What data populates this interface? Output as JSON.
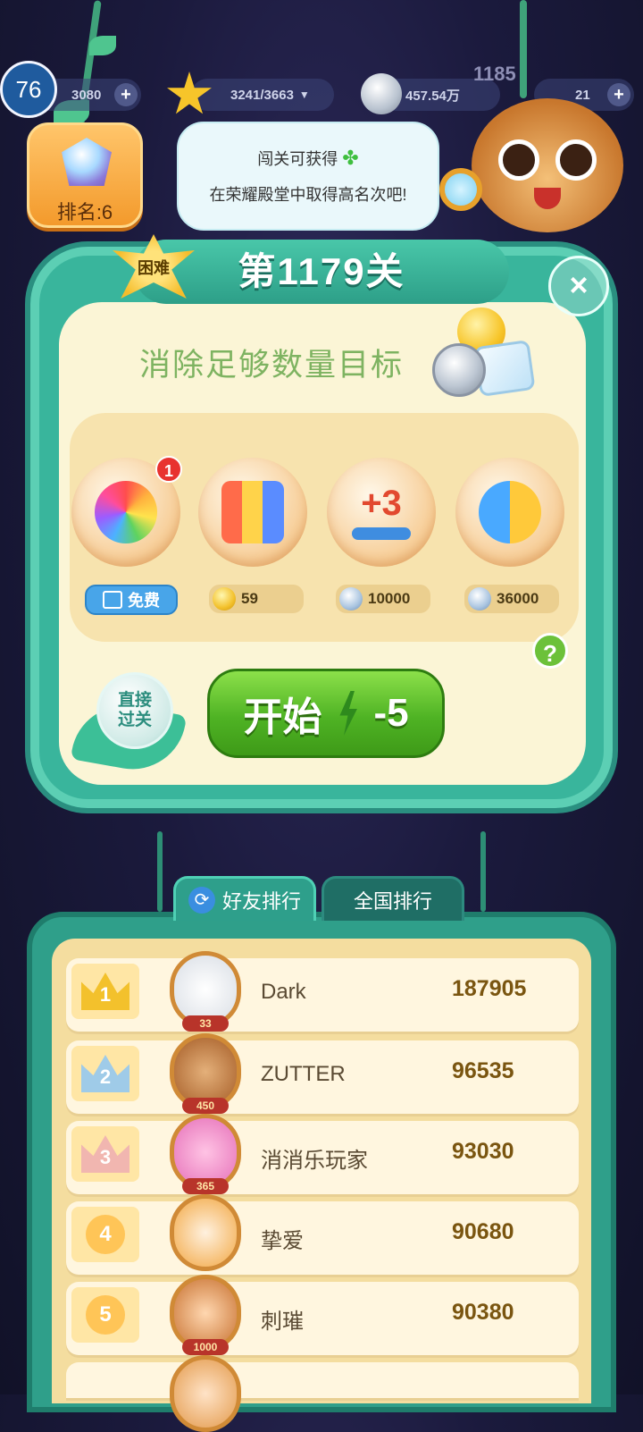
{
  "hud": {
    "level": "76",
    "partial_gold": "3080",
    "stars": "3241/3663",
    "coins": "457.54万",
    "bg_number": "1185",
    "gems": "21"
  },
  "rank_badge": {
    "label": "排名:6"
  },
  "bubble": {
    "line1": "闯关可获得",
    "line2": "在荣耀殿堂中取得高名次吧!"
  },
  "panel": {
    "difficulty": "困难",
    "title": "第1179关",
    "goal": "消除足够数量目标",
    "close_icon": "close-icon"
  },
  "boosters": [
    {
      "name": "rainbow-owl-booster",
      "price": "免费",
      "badge": "1",
      "currency": "free-video"
    },
    {
      "name": "firework-booster",
      "price": "59",
      "currency": "gold"
    },
    {
      "name": "plus-three-moves-booster",
      "price": "10000",
      "currency": "silver"
    },
    {
      "name": "animal-swap-booster",
      "price": "36000",
      "currency": "silver"
    }
  ],
  "actions": {
    "skip": "直接过关",
    "start": "开始",
    "energy_cost": "-5",
    "help": "?"
  },
  "tabs": {
    "friends": "好友排行",
    "national": "全国排行"
  },
  "leaderboard": [
    {
      "rank": "1",
      "name": "Dark",
      "score": "187905",
      "level": "33"
    },
    {
      "rank": "2",
      "name": "ZUTTER",
      "score": "96535",
      "level": "450"
    },
    {
      "rank": "3",
      "name": "消消乐玩家",
      "score": "93030",
      "level": "365"
    },
    {
      "rank": "4",
      "name": "挚爱",
      "score": "90680",
      "level": ""
    },
    {
      "rank": "5",
      "name": "刺璀",
      "score": "90380",
      "level": "1000"
    }
  ],
  "colors": {
    "panel_green": "#39b59c",
    "start_green": "#4fb324",
    "cream": "#fbf5d6",
    "rank_orange": "#f39a2c"
  }
}
